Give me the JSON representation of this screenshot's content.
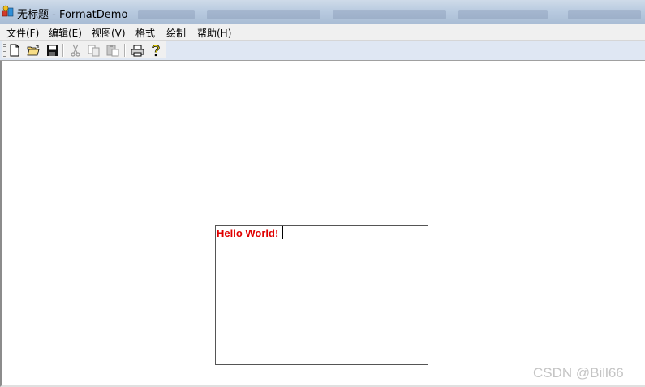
{
  "window": {
    "title": "无标题 - FormatDemo",
    "icon": "app-icon"
  },
  "menu": {
    "items": [
      {
        "label": "文件(F)"
      },
      {
        "label": "编辑(E)"
      },
      {
        "label": "视图(V)"
      },
      {
        "label": "格式"
      },
      {
        "label": "绘制"
      },
      {
        "label": "帮助(H)"
      }
    ]
  },
  "toolbar": {
    "buttons": [
      "new-icon",
      "open-icon",
      "save-icon",
      "cut-icon",
      "copy-icon",
      "paste-icon",
      "print-icon",
      "help-icon"
    ],
    "disabled": [
      "cut-icon",
      "copy-icon",
      "paste-icon"
    ]
  },
  "document": {
    "text": "Hello World!",
    "text_color": "#e00000"
  },
  "watermark": "CSDN @Bill66"
}
